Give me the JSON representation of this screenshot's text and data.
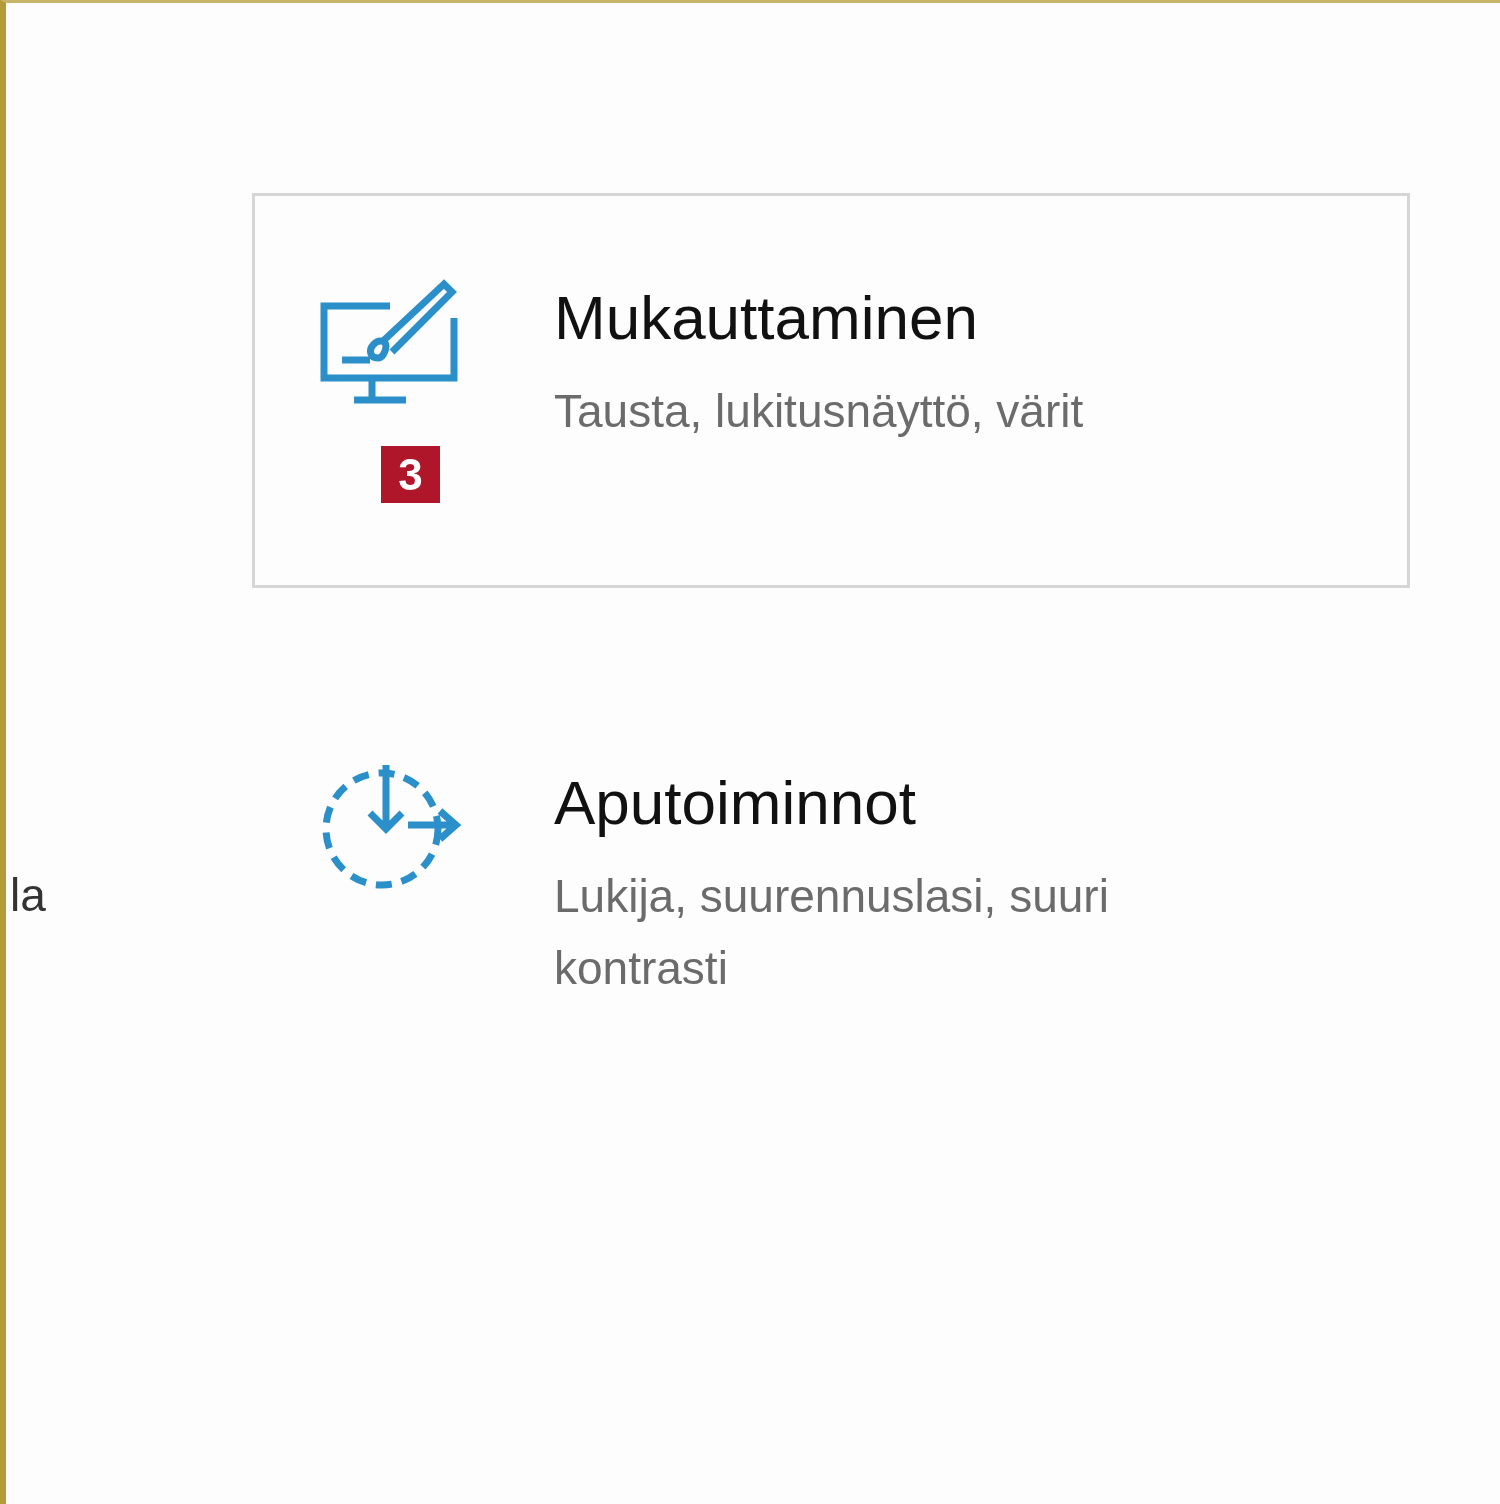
{
  "left_edge_text": "la",
  "categories": [
    {
      "kind": "personalization",
      "title": "Mukauttaminen",
      "description": "Tausta, lukitusnäyttö, värit",
      "selected": true,
      "badge": "3"
    },
    {
      "kind": "accessibility",
      "title": "Aputoiminnot",
      "description": "Lukija, suurennuslasi, suuri kontrasti",
      "selected": false
    }
  ]
}
